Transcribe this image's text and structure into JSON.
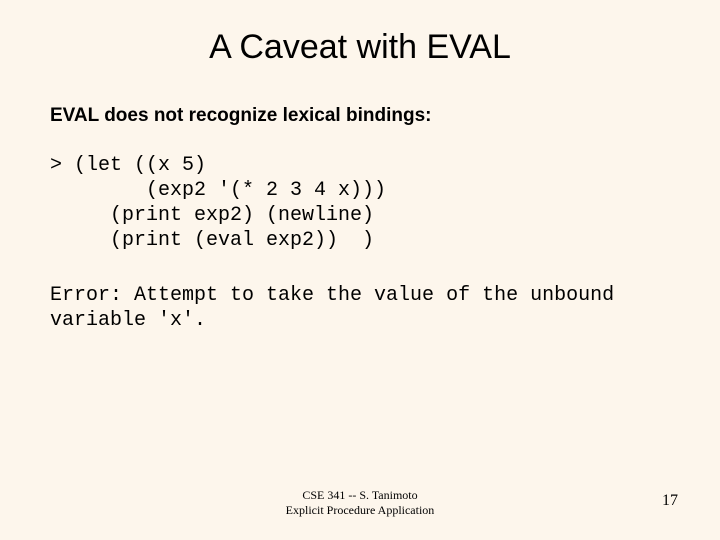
{
  "title": "A Caveat with EVAL",
  "intro": "EVAL does not recognize lexical bindings:",
  "code": "> (let ((x 5)\n        (exp2 '(* 2 3 4 x)))\n     (print exp2) (newline)\n     (print (eval exp2))  )",
  "error": "Error: Attempt to take the value of the unbound variable 'x'.",
  "footer_line1": "CSE 341 -- S. Tanimoto",
  "footer_line2": "Explicit Procedure Application",
  "page_number": "17"
}
